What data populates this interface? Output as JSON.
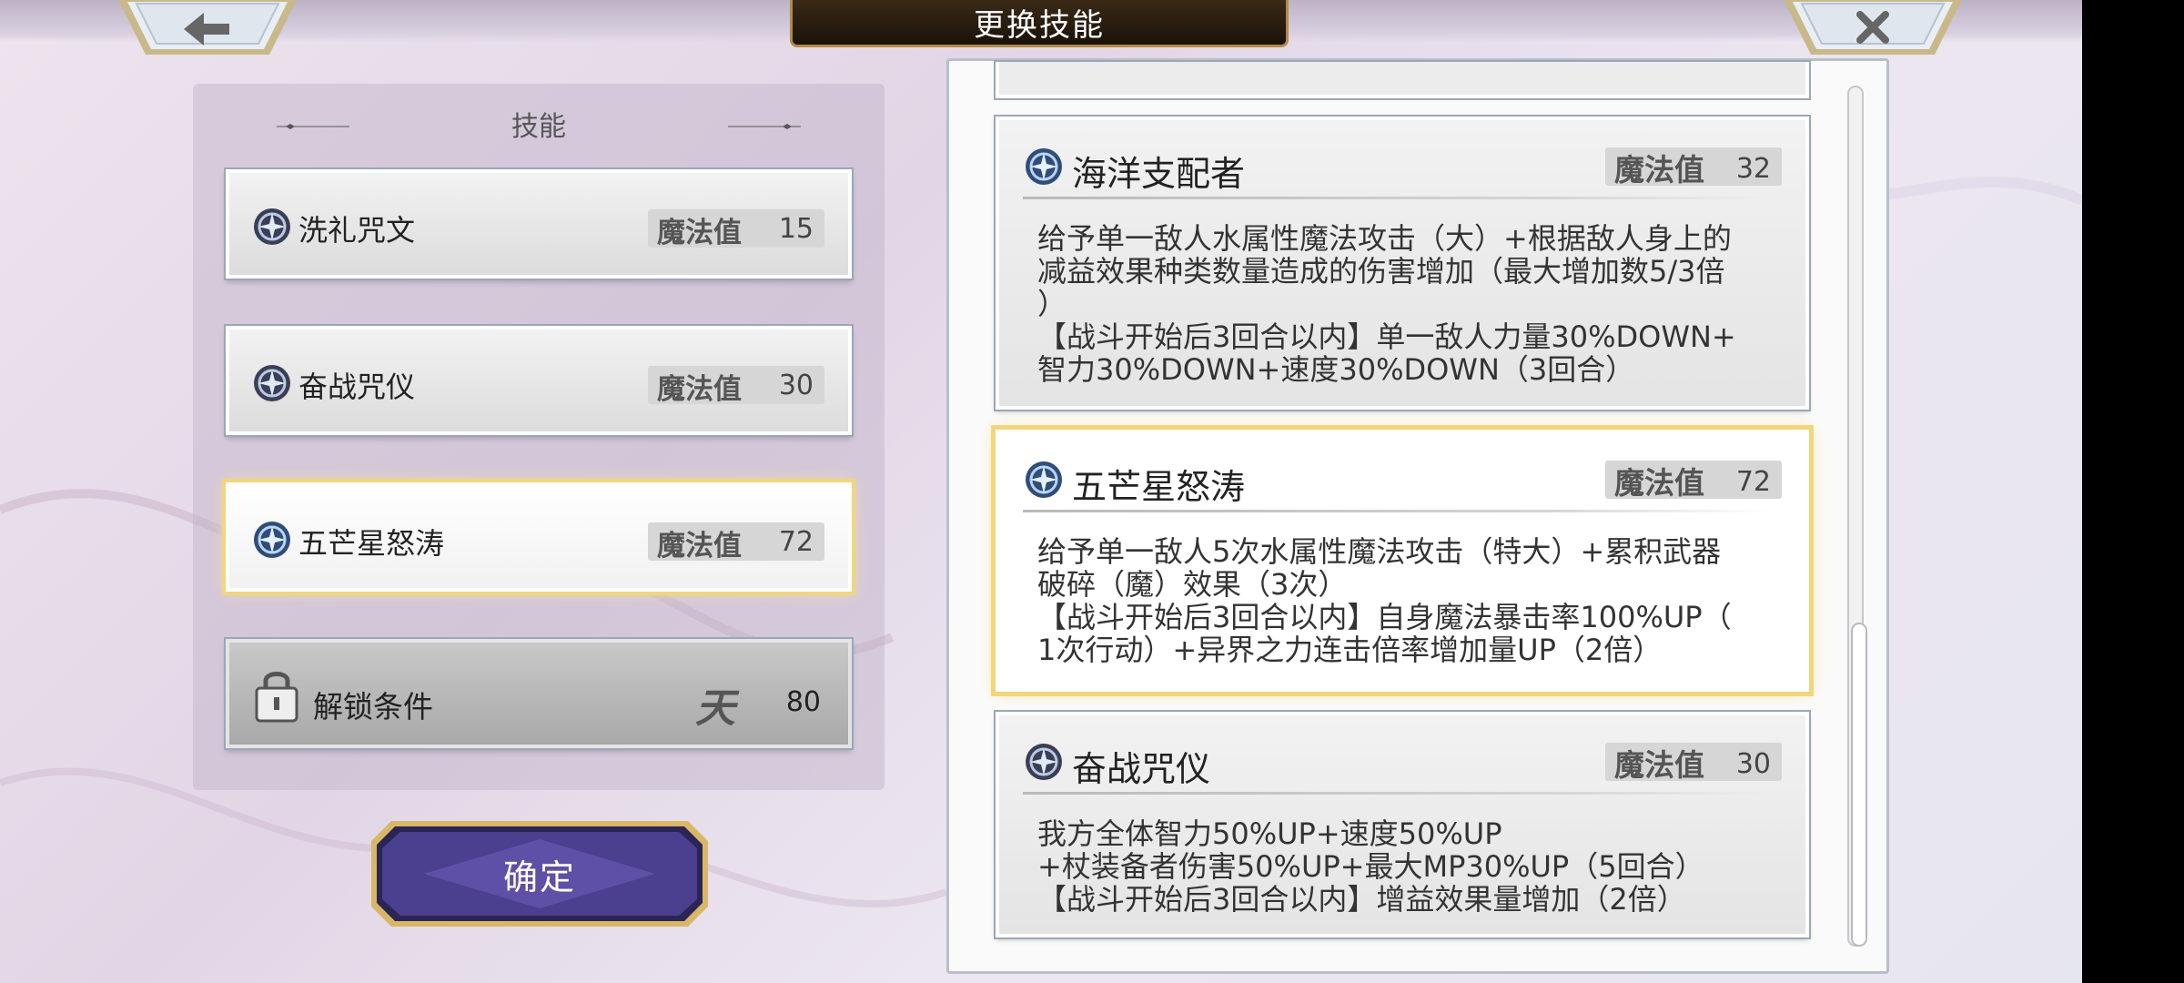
{
  "header": {
    "title": "更换技能"
  },
  "left_panel": {
    "section_title": "技能",
    "skills": [
      {
        "name": "洗礼咒文",
        "mp_label": "魔法值",
        "mp": "15"
      },
      {
        "name": "奋战咒仪",
        "mp_label": "魔法值",
        "mp": "30"
      },
      {
        "name": "五芒星怒涛",
        "mp_label": "魔法值",
        "mp": "72"
      }
    ],
    "locked_slot": {
      "label": "解锁条件",
      "icon_char": "天",
      "value": "80"
    },
    "confirm_label": "确定"
  },
  "right_panel": {
    "cards": [
      {
        "name": "海洋支配者",
        "mp_label": "魔法值",
        "mp": "32",
        "desc": "给予单一敌人水属性魔法攻击（大）+根据敌人身上的\n减益效果种类数量造成的伤害增加（最大增加数5/3倍\n）\n【战斗开始后3回合以内】单一敌人力量30%DOWN+\n智力30%DOWN+速度30%DOWN（3回合）"
      },
      {
        "name": "五芒星怒涛",
        "mp_label": "魔法值",
        "mp": "72",
        "desc": "给予单一敌人5次水属性魔法攻击（特大）+累积武器\n破碎（魔）效果（3次）\n【战斗开始后3回合以内】自身魔法暴击率100%UP（\n1次行动）+异界之力连击倍率增加量UP（2倍）"
      },
      {
        "name": "奋战咒仪",
        "mp_label": "魔法值",
        "mp": "30",
        "desc": "我方全体智力50%UP+速度50%UP\n+杖装备者伤害50%UP+最大MP30%UP（5回合）\n【战斗开始后3回合以内】增益效果量增加（2倍）"
      }
    ]
  },
  "colors": {
    "selected_glow": "#f1d67b",
    "confirm_button": "#4b3f8f",
    "title_plate": "#2a1e10"
  }
}
